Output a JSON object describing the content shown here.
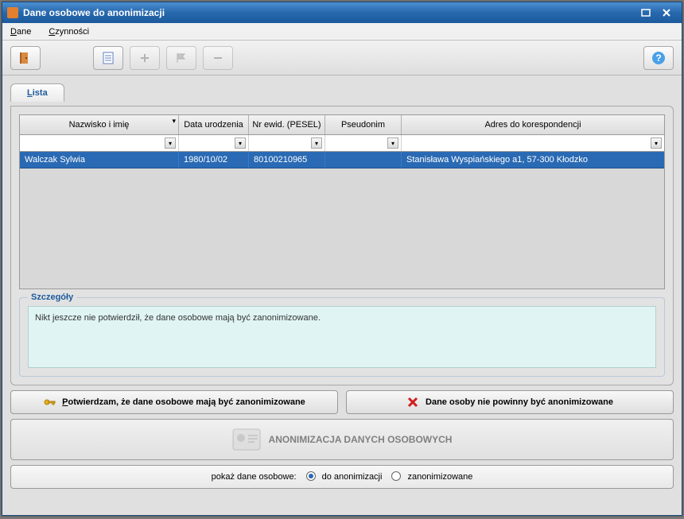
{
  "window": {
    "title": "Dane osobowe do anonimizacji"
  },
  "menu": {
    "dane": "Dane",
    "czynnosci": "Czynności"
  },
  "tabs": {
    "lista": "Lista"
  },
  "columns": {
    "name": "Nazwisko i imię",
    "birth": "Data urodzenia",
    "pesel": "Nr ewid. (PESEL)",
    "alias": "Pseudonim",
    "addr": "Adres do korespondencji"
  },
  "rows": [
    {
      "name": "Walczak Sylwia",
      "birth": "1980/10/02",
      "pesel": "80100210965",
      "alias": "",
      "addr": "Stanisława Wyspiańskiego a1, 57-300 Kłodzko"
    }
  ],
  "details": {
    "legend": "Szczegóły",
    "text": "Nikt jeszcze nie potwierdził, że dane osobowe mają być zanonimizowane."
  },
  "buttons": {
    "confirm": "Potwierdzam, że dane osobowe mają być zanonimizowane",
    "deny": "Dane osoby nie powinny być anonimizowane",
    "anon_panel": "ANONIMIZACJA DANYCH OSOBOWYCH"
  },
  "radio": {
    "label": "pokaż dane osobowe:",
    "opt1": "do anonimizacji",
    "opt2": "zanonimizowane",
    "checked": "opt1"
  }
}
